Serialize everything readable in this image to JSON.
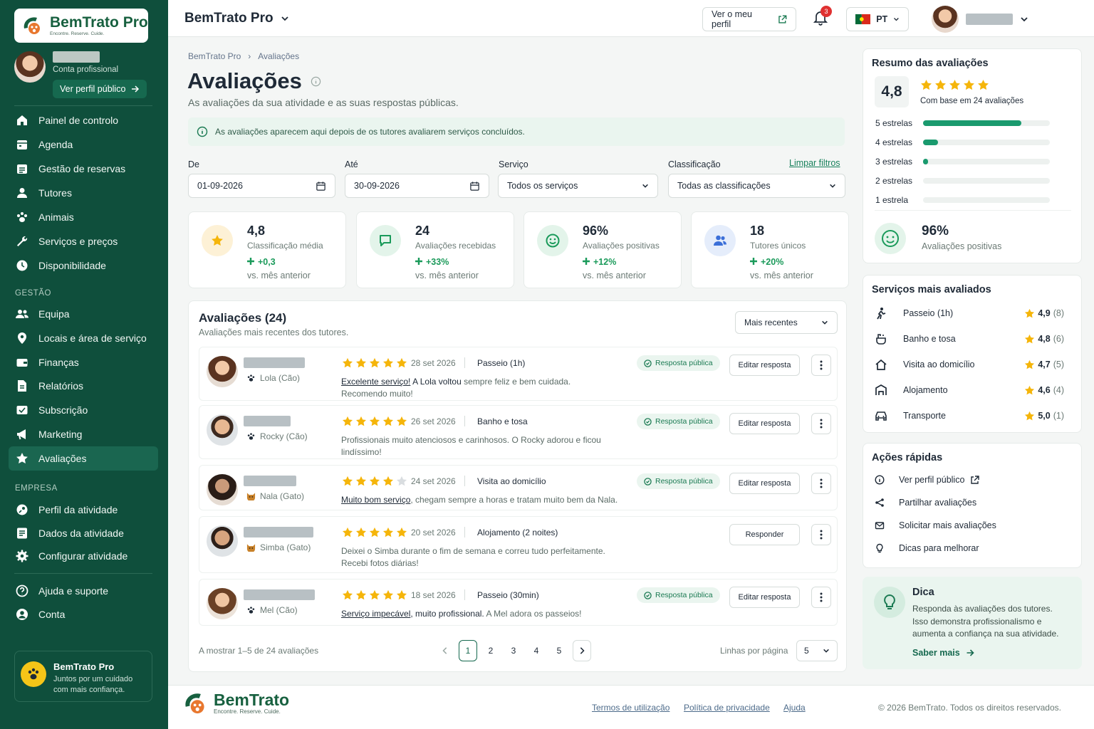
{
  "colors": {
    "primary": "#0f4f3c",
    "accent": "#1a9a6e",
    "star": "#f5b50a",
    "positive": "#1a9a5a"
  },
  "sidebar": {
    "logo_title": "BemTrato Pro",
    "logo_tagline": "Encontre. Reserve. Cuide.",
    "account_type": "Conta profissional",
    "public_profile_btn": "Ver perfil público",
    "nav_main": [
      {
        "label": "Painel de controlo",
        "icon": "home-icon"
      },
      {
        "label": "Agenda",
        "icon": "calendar-icon"
      },
      {
        "label": "Gestão de reservas",
        "icon": "bookings-icon"
      },
      {
        "label": "Tutores",
        "icon": "user-icon"
      },
      {
        "label": "Animais",
        "icon": "paw-icon"
      },
      {
        "label": "Serviços e preços",
        "icon": "wrench-icon"
      },
      {
        "label": "Disponibilidade",
        "icon": "clock-icon"
      }
    ],
    "section_gestao": "GESTÃO",
    "nav_gestao": [
      {
        "label": "Equipa",
        "icon": "team-icon"
      },
      {
        "label": "Locais e área de serviço",
        "icon": "location-icon"
      },
      {
        "label": "Finanças",
        "icon": "wallet-icon"
      },
      {
        "label": "Relatórios",
        "icon": "report-icon"
      },
      {
        "label": "Subscrição",
        "icon": "subscription-icon"
      },
      {
        "label": "Marketing",
        "icon": "megaphone-icon"
      },
      {
        "label": "Avaliações",
        "icon": "star-icon"
      }
    ],
    "section_empresa": "EMPRESA",
    "nav_empresa": [
      {
        "label": "Perfil da atividade",
        "icon": "profile-icon"
      },
      {
        "label": "Dados da atividade",
        "icon": "data-icon"
      },
      {
        "label": "Configurar atividade",
        "icon": "gear-icon"
      }
    ],
    "nav_bottom": [
      {
        "label": "Ajuda e suporte",
        "icon": "help-icon"
      },
      {
        "label": "Conta",
        "icon": "account-icon"
      }
    ],
    "promo_title": "BemTrato Pro",
    "promo_text": "Juntos por um cuidado com mais confiança."
  },
  "topbar": {
    "brand": "BemTrato Pro",
    "view_profile": "Ver o meu perfil",
    "notif_count": "3",
    "language": "PT"
  },
  "page": {
    "breadcrumb": [
      "BemTrato Pro",
      "Avaliações"
    ],
    "title": "Avaliações",
    "subtitle": "As avaliações da sua atividade e as suas respostas públicas.",
    "info": "As avaliações aparecem aqui depois de os tutores avaliarem serviços concluídos."
  },
  "filters": {
    "from_label": "De",
    "from_value": "01-09-2026",
    "to_label": "Até",
    "to_value": "30-09-2026",
    "service_label": "Serviço",
    "service_value": "Todos os serviços",
    "rating_label": "Classificação",
    "rating_value": "Todas as classificações",
    "clear": "Limpar filtros"
  },
  "kpis": [
    {
      "value": "4,8",
      "label": "Classificação média",
      "delta": "+0,3",
      "vs": "vs. mês anterior",
      "icon": "star-icon"
    },
    {
      "value": "24",
      "label": "Avaliações recebidas",
      "delta": "+33%",
      "vs": "vs. mês anterior",
      "icon": "chat-icon"
    },
    {
      "value": "96%",
      "label": "Avaliações positivas",
      "delta": "+12%",
      "vs": "vs. mês anterior",
      "icon": "smile-icon"
    },
    {
      "value": "18",
      "label": "Tutores únicos",
      "delta": "+20%",
      "vs": "vs. mês anterior",
      "icon": "users-icon"
    }
  ],
  "reviews": {
    "title": "Avaliações (24)",
    "subtitle": "Avaliações mais recentes dos tutores.",
    "sort": "Mais recentes",
    "public_badge": "Resposta pública",
    "edit_label": "Editar resposta",
    "reply_label": "Responder",
    "items": [
      {
        "pet": "Lola (Cão)",
        "stars": 5,
        "date": "28 set 2026",
        "service": "Passeio (1h)",
        "text_u": "Excelente serviço!",
        "text_b": " A Lola voltou",
        "text": " sempre feliz e bem cuidada. Recomendo muito!",
        "answered": true
      },
      {
        "pet": "Rocky (Cão)",
        "stars": 5,
        "date": "26 set 2026",
        "service": "Banho e tosa",
        "text_u": "",
        "text_b": "",
        "text": "Profissionais muito atenciosos e carinhosos. O Rocky adorou e ficou lindíssimo!",
        "answered": true
      },
      {
        "pet": "Nala (Gato)",
        "stars": 4,
        "date": "24 set 2026",
        "service": "Visita ao domicílio",
        "text_u": "Muito bom serviço",
        "text_b": "",
        "text": ", chegam sempre a horas e tratam muito bem da Nala.",
        "answered": true
      },
      {
        "pet": "Simba (Gato)",
        "stars": 5,
        "date": "20 set 2026",
        "service": "Alojamento (2 noites)",
        "text_u": "",
        "text_b": "",
        "text": "Deixei o Simba durante o fim de semana e correu tudo perfeitamente. Recebi fotos diárias!",
        "answered": false
      },
      {
        "pet": "Mel (Cão)",
        "stars": 5,
        "date": "18 set 2026",
        "service": "Passeio (30min)",
        "text_u": "Serviço impecável",
        "text_b": ", muito profissional.",
        "text": " A Mel adora os passeios!",
        "answered": true
      }
    ],
    "showing": "A mostrar 1–5 de 24 avaliações",
    "pages": [
      "1",
      "2",
      "3",
      "4",
      "5"
    ],
    "current_page": "1",
    "rows_label": "Linhas por página",
    "rows_value": "5"
  },
  "summary": {
    "title": "Resumo das avaliações",
    "score": "4,8",
    "based_on": "Com base em 24 avaliações",
    "distribution": [
      {
        "label": "5 estrelas",
        "count": 20
      },
      {
        "label": "4 estrelas",
        "count": 3
      },
      {
        "label": "3 estrelas",
        "count": 1
      },
      {
        "label": "2 estrelas",
        "count": 0
      },
      {
        "label": "1 estrela",
        "count": 0
      }
    ],
    "positive_value": "96%",
    "positive_label": "Avaliações positivas"
  },
  "top_services": {
    "title": "Serviços mais avaliados",
    "items": [
      {
        "name": "Passeio (1h)",
        "score": "4,9",
        "count": "(8)",
        "icon": "walk-icon"
      },
      {
        "name": "Banho e tosa",
        "score": "4,8",
        "count": "(6)",
        "icon": "bath-icon"
      },
      {
        "name": "Visita ao domicílio",
        "score": "4,7",
        "count": "(5)",
        "icon": "house-icon"
      },
      {
        "name": "Alojamento",
        "score": "4,6",
        "count": "(4)",
        "icon": "lodging-icon"
      },
      {
        "name": "Transporte",
        "score": "5,0",
        "count": "(1)",
        "icon": "car-icon"
      }
    ]
  },
  "quick_actions": {
    "title": "Ações rápidas",
    "items": [
      {
        "label": "Ver perfil público",
        "icon": "info-icon"
      },
      {
        "label": "Partilhar avaliações",
        "icon": "share-icon"
      },
      {
        "label": "Solicitar mais avaliações",
        "icon": "mail-icon"
      },
      {
        "label": "Dicas para melhorar",
        "icon": "bulb-icon"
      }
    ]
  },
  "tip": {
    "title": "Dica",
    "text": "Responda às avaliações dos tutores. Isso demonstra profissionalismo e aumenta a confiança na sua atividade.",
    "link": "Saber mais"
  },
  "footer": {
    "logo": "BemTrato",
    "tagline": "Encontre. Reserve. Cuide.",
    "terms": "Termos de utilização",
    "privacy": "Política de privacidade",
    "help": "Ajuda",
    "copyright": "© 2026 BemTrato. Todos os direitos reservados."
  }
}
